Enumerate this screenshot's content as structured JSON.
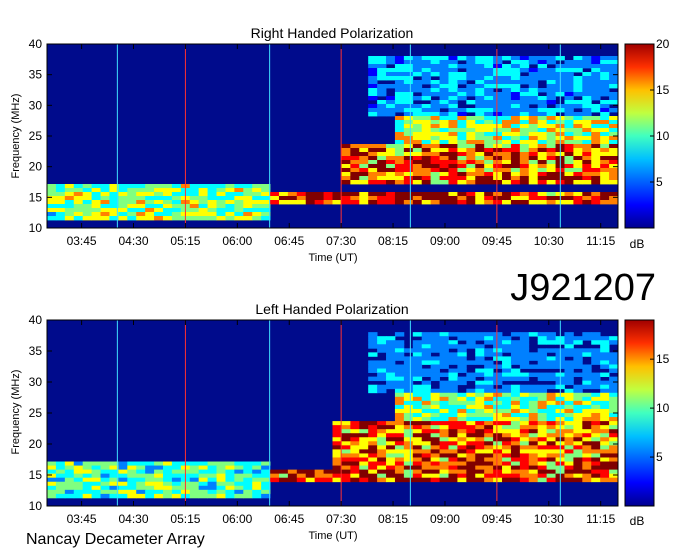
{
  "observation_id": "J921207",
  "instrument": "Nancay Decameter Array",
  "colors": {
    "colormap": [
      "#00008f",
      "#0000ff",
      "#0080ff",
      "#00ffff",
      "#80ff80",
      "#ffff00",
      "#ff8000",
      "#ff0000",
      "#800000"
    ],
    "background_hex": "#000b8c",
    "marker_red": "#ff3030",
    "marker_cyan": "#40e0ff"
  },
  "chart_data": [
    {
      "type": "heatmap",
      "title": "Right Handed Polarization",
      "xlabel": "Time (UT)",
      "ylabel": "Frequency (MHz)",
      "x_ticks": [
        "03:45",
        "04:30",
        "05:15",
        "06:00",
        "06:45",
        "07:30",
        "08:15",
        "09:00",
        "09:45",
        "10:30",
        "11:15"
      ],
      "x_tick_minutes": [
        225,
        270,
        315,
        360,
        405,
        450,
        495,
        540,
        585,
        630,
        675
      ],
      "xlim_minutes": [
        195,
        690
      ],
      "y_ticks": [
        10,
        15,
        20,
        25,
        30,
        35,
        40
      ],
      "ylim": [
        10,
        40
      ],
      "colorbar": {
        "ticks": [
          5,
          10,
          15,
          20
        ],
        "range": [
          0,
          20
        ],
        "unit": "dB"
      },
      "marker_lines": [
        {
          "t": 315,
          "color": "red"
        },
        {
          "t": 450,
          "color": "red"
        },
        {
          "t": 585,
          "color": "red"
        },
        {
          "t": 256,
          "color": "cyan"
        },
        {
          "t": 388,
          "color": "cyan"
        },
        {
          "t": 510,
          "color": "cyan"
        },
        {
          "t": 640,
          "color": "cyan"
        }
      ],
      "emission_bands_mhz": [
        {
          "fmin": 11,
          "fmax": 17,
          "tmin": 195,
          "tmax": 390,
          "level": 12
        },
        {
          "fmin": 14,
          "fmax": 16,
          "tmin": 388,
          "tmax": 690,
          "level": 20
        },
        {
          "fmin": 17,
          "fmax": 24,
          "tmin": 450,
          "tmax": 690,
          "level": 18
        },
        {
          "fmin": 24,
          "fmax": 28,
          "tmin": 500,
          "tmax": 690,
          "level": 13
        },
        {
          "fmin": 28,
          "fmax": 38,
          "tmin": 470,
          "tmax": 690,
          "level": 7
        }
      ]
    },
    {
      "type": "heatmap",
      "title": "Left Handed Polarization",
      "xlabel": "Time (UT)",
      "ylabel": "Frequency (MHz)",
      "x_ticks": [
        "03:45",
        "04:30",
        "05:15",
        "06:00",
        "06:45",
        "07:30",
        "08:15",
        "09:00",
        "09:45",
        "10:30",
        "11:15"
      ],
      "x_tick_minutes": [
        225,
        270,
        315,
        360,
        405,
        450,
        495,
        540,
        585,
        630,
        675
      ],
      "xlim_minutes": [
        195,
        690
      ],
      "y_ticks": [
        10,
        15,
        20,
        25,
        30,
        35,
        40
      ],
      "ylim": [
        10,
        40
      ],
      "colorbar": {
        "ticks": [
          5,
          10,
          15
        ],
        "range": [
          0,
          19
        ],
        "unit": "dB"
      },
      "marker_lines": [
        {
          "t": 315,
          "color": "red"
        },
        {
          "t": 450,
          "color": "red"
        },
        {
          "t": 585,
          "color": "red"
        },
        {
          "t": 256,
          "color": "cyan"
        },
        {
          "t": 388,
          "color": "cyan"
        },
        {
          "t": 510,
          "color": "cyan"
        },
        {
          "t": 640,
          "color": "cyan"
        }
      ],
      "emission_bands_mhz": [
        {
          "fmin": 11,
          "fmax": 17,
          "tmin": 195,
          "tmax": 390,
          "level": 10
        },
        {
          "fmin": 14,
          "fmax": 16,
          "tmin": 388,
          "tmax": 690,
          "level": 18
        },
        {
          "fmin": 16,
          "fmax": 24,
          "tmin": 440,
          "tmax": 690,
          "level": 17
        },
        {
          "fmin": 24,
          "fmax": 28,
          "tmin": 500,
          "tmax": 690,
          "level": 12
        },
        {
          "fmin": 28,
          "fmax": 38,
          "tmin": 470,
          "tmax": 690,
          "level": 6
        }
      ]
    }
  ]
}
